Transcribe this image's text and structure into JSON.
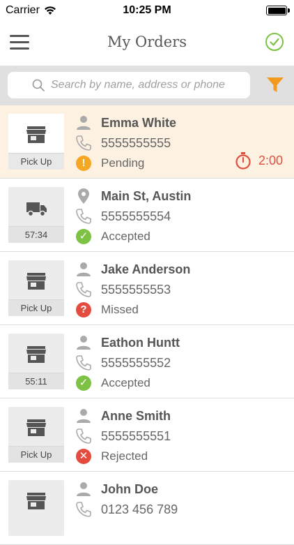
{
  "status_bar": {
    "carrier": "Carrier",
    "time": "10:25 PM"
  },
  "header": {
    "title": "My Orders"
  },
  "search": {
    "placeholder": "Search by name, address or phone"
  },
  "colors": {
    "accent_orange": "#f39a1e",
    "accepted_green": "#7dc243",
    "pending_orange": "#f5a623",
    "missed_red": "#e34c3f",
    "highlight_bg": "#fdf1e2"
  },
  "orders": [
    {
      "type_icon": "store-icon",
      "type_label": "Pick Up",
      "top_icon": "person-icon",
      "name": "Emma White",
      "phone": "5555555555",
      "status": "Pending",
      "status_icon": "!",
      "timer": "2:00"
    },
    {
      "type_icon": "truck-icon",
      "type_label": "57:34",
      "top_icon": "location-pin-icon",
      "name": "Main St, Austin",
      "phone": "5555555554",
      "status": "Accepted",
      "status_icon": "✓"
    },
    {
      "type_icon": "store-icon",
      "type_label": "Pick Up",
      "top_icon": "person-icon",
      "name": "Jake Anderson",
      "phone": "5555555553",
      "status": "Missed",
      "status_icon": "?"
    },
    {
      "type_icon": "store-icon",
      "type_label": "55:11",
      "top_icon": "person-icon",
      "name": "Eathon Huntt",
      "phone": "5555555552",
      "status": "Accepted",
      "status_icon": "✓"
    },
    {
      "type_icon": "store-icon",
      "type_label": "Pick Up",
      "top_icon": "person-icon",
      "name": "Anne Smith",
      "phone": "5555555551",
      "status": "Rejected",
      "status_icon": "✕"
    },
    {
      "type_icon": "store-icon",
      "top_icon": "person-icon",
      "name": "John Doe",
      "phone": "0123 456 789"
    }
  ]
}
